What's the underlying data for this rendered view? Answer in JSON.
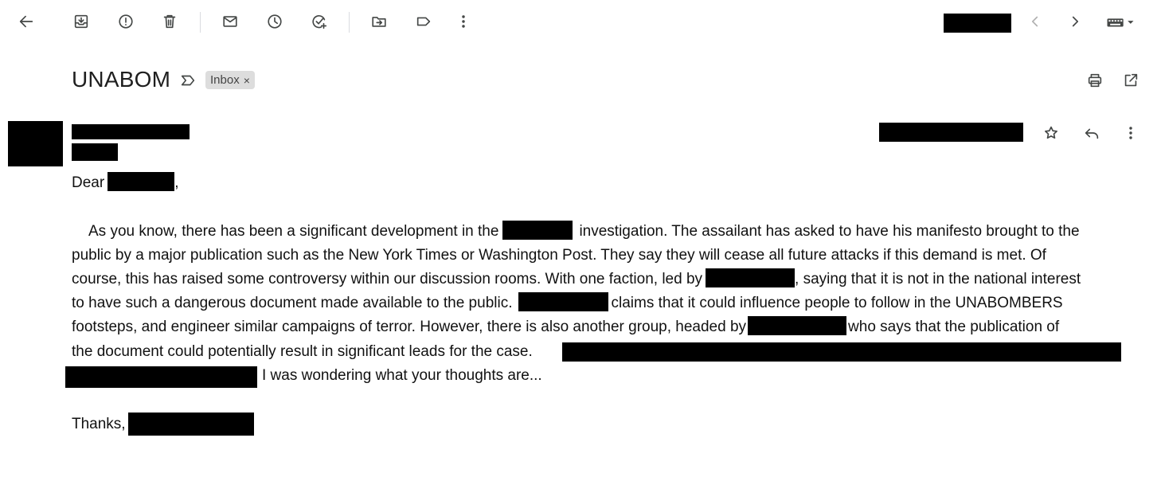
{
  "toolbar": {
    "icons": [
      "back-arrow-icon",
      "archive-icon",
      "report-spam-icon",
      "delete-icon",
      "mark-unread-icon",
      "snooze-icon",
      "add-to-tasks-icon",
      "move-to-icon",
      "label-icon",
      "more-vert-icon"
    ],
    "pager_icons": [
      "chevron-left-icon",
      "chevron-right-icon",
      "keyboard-icon"
    ]
  },
  "email": {
    "subject": "UNABOM",
    "label_chip": "Inbox",
    "label_chip_remove": "×",
    "greeting_prefix": "Dear",
    "greeting_suffix": ",",
    "body": {
      "line1_a": "As you know, there has been a significant development in the",
      "line1_b": "investigation. The assailant has asked to have his manifesto brought to the",
      "line2": "public by a major publication such as the New York Times or Washington Post. They say they will cease all future attacks if this demand is met. Of",
      "line3_a": "course, this has raised some controversy within our discussion rooms. With one faction, led by",
      "line3_b": ", saying that it is not in the national interest",
      "line4_a": "to have such a dangerous document made available to the public.",
      "line4_b": "claims that it could influence people to follow in the UNABOMBERS",
      "line5_a": "footsteps, and engineer similar campaigns of terror. However, there is also another group, headed by",
      "line5_b": "who says that the publication of",
      "line6": "the document could potentially result in significant leads for the case.",
      "line7": "I was wondering what your thoughts are..."
    },
    "signoff": "Thanks,"
  }
}
